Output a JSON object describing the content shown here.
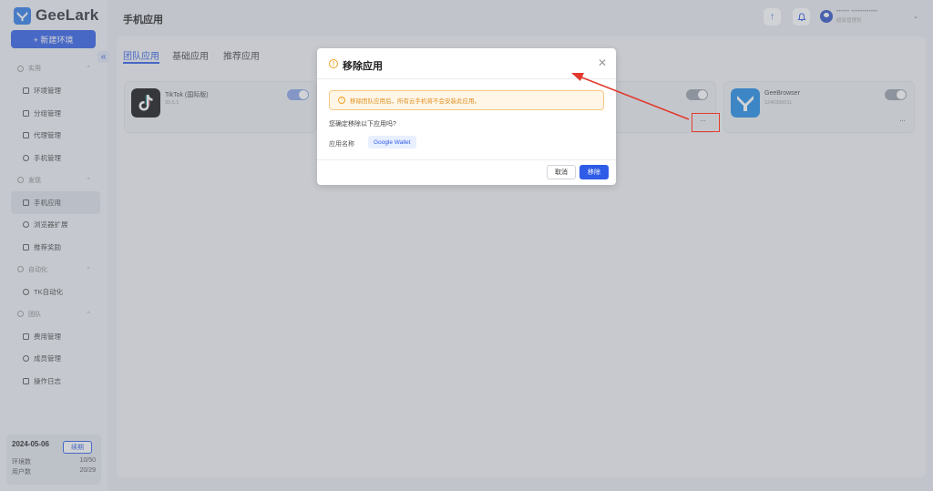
{
  "app": {
    "logo_text": "GeeLark"
  },
  "sidebar": {
    "new_env_label": "+ 新建环境",
    "collapse_glyph": "«",
    "groups": [
      {
        "label": "实用",
        "items": [
          "环境管理",
          "分组管理",
          "代理管理",
          "手机管理"
        ]
      },
      {
        "label": "发现",
        "items": [
          "手机应用",
          "浏览器扩展",
          "推荐奖励"
        ]
      },
      {
        "label": "自动化",
        "items": [
          "TK自动化"
        ]
      },
      {
        "label": "团队",
        "items": [
          "费用管理",
          "成员管理",
          "操作日志"
        ]
      }
    ],
    "active_item": "手机应用",
    "plan": {
      "date": "2024-05-06",
      "renew_label": "续期",
      "env_label": "环境数",
      "env_value": "10/50",
      "user_label": "用户数",
      "user_value": "20/29"
    }
  },
  "header": {
    "title": "手机应用",
    "upload_glyph": "↑",
    "bell_glyph": "🔔",
    "user_line1": "•••••• ••••••••••••",
    "user_line2": "超级管理员",
    "caret": "⌄"
  },
  "tabs": [
    {
      "label": "团队应用",
      "active": true
    },
    {
      "label": "基础应用",
      "active": false
    },
    {
      "label": "推荐应用",
      "active": false
    }
  ],
  "apps": [
    {
      "name": "TikTok (国际版)",
      "version": "33.5.1",
      "enabled": true
    },
    {
      "name": "GeeBrowser",
      "version": "1240306011",
      "enabled": false
    }
  ],
  "more_glyph": "···",
  "modal": {
    "title": "移除应用",
    "title_icon": "!",
    "close_glyph": "✕",
    "alert_icon": "!",
    "alert_text": "移除团队应用后，所有云手机将不会安装此应用。",
    "confirm_text": "您确定移除以下应用吗?",
    "field_label": "应用名称",
    "field_value": "Google Wallet",
    "cancel_label": "取消",
    "remove_label": "移除"
  },
  "colors": {
    "primary": "#2f5ce6",
    "warning": "#f0a020",
    "annotation_red": "#e23b2e"
  }
}
